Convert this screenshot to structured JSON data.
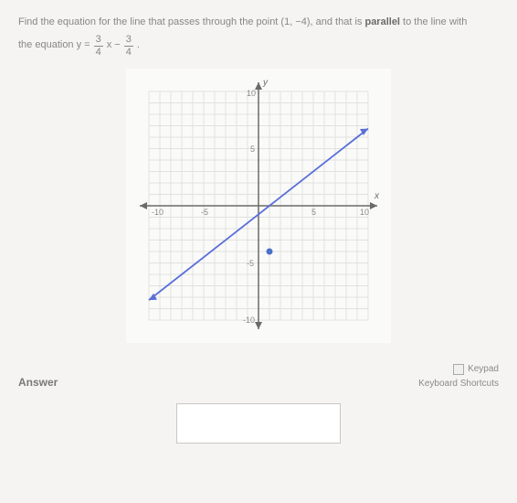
{
  "question": {
    "prefix": "Find the equation for the line that passes through the point ",
    "point": "(1, −4)",
    "mid": ", and that is ",
    "keyword": "parallel",
    "suffix": " to the line with",
    "eq_lead": "the equation y = ",
    "frac1_num": "3",
    "frac1_den": "4",
    "x": "x − ",
    "frac2_num": "3",
    "frac2_den": "4",
    "period": "."
  },
  "chart_data": {
    "type": "line",
    "title": "",
    "xlabel": "x",
    "ylabel": "y",
    "xlim": [
      -10,
      10
    ],
    "ylim": [
      -10,
      10
    ],
    "ticks": {
      "x": [
        -10,
        -5,
        5,
        10
      ],
      "y": [
        -10,
        -5,
        5,
        10
      ]
    },
    "tick_labels": {
      "neg10": "-10",
      "neg5": "-5",
      "pos5": "5",
      "pos10": "10",
      "top10": "10"
    },
    "series": [
      {
        "name": "given-line",
        "type": "line",
        "slope": 0.75,
        "intercept": -0.75,
        "x": [
          -10,
          10
        ],
        "y": [
          -8.25,
          6.75
        ]
      }
    ],
    "points": [
      {
        "name": "target-point",
        "x": 1,
        "y": -4
      }
    ]
  },
  "footer": {
    "answer_label": "Answer",
    "keypad": "Keypad",
    "shortcuts": "Keyboard Shortcuts"
  }
}
